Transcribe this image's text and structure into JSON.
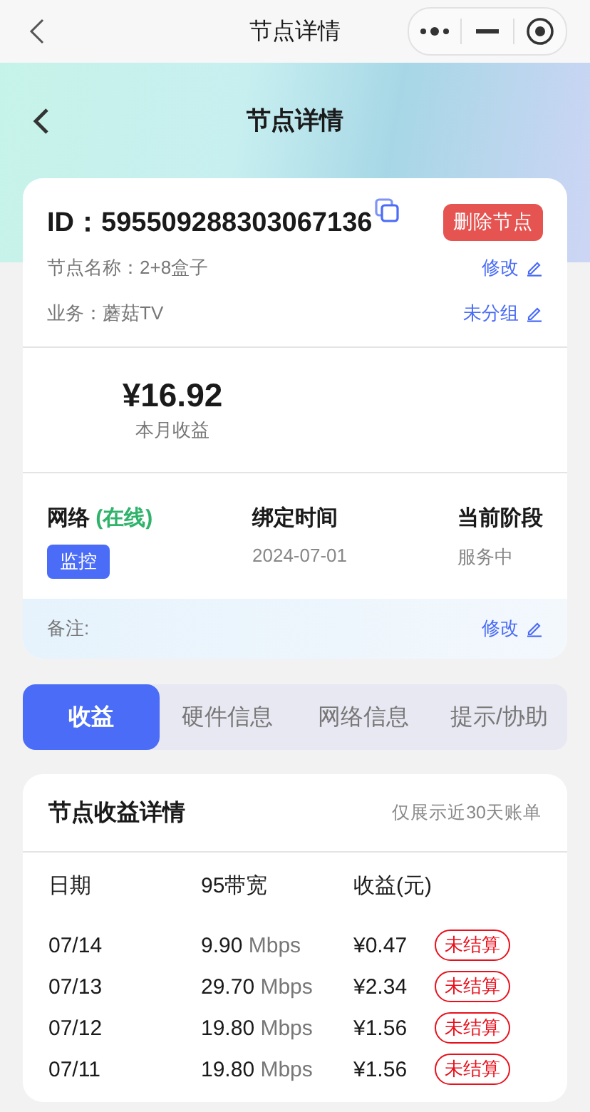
{
  "mini_bar": {
    "title": "节点详情"
  },
  "header": {
    "title": "节点详情"
  },
  "node": {
    "id_label": "ID：",
    "id": "595509288303067136",
    "delete_button": "删除节点",
    "name": "节点名称：2+8盒子",
    "name_action": "修改",
    "business": "业务：蘑菇TV",
    "group_action": "未分组",
    "income": "¥16.92",
    "income_label": "本月收益",
    "network_label": "网络",
    "network_status": "(在线)",
    "online": true,
    "monitor_button": "监控",
    "bind_label": "绑定时间",
    "bind_value": "2024-07-01",
    "stage_label": "当前阶段",
    "stage_value": "服务中",
    "note_label": "备注:",
    "note_action": "修改"
  },
  "tabs": [
    {
      "label": "收益",
      "selected": true
    },
    {
      "label": "硬件信息",
      "selected": false
    },
    {
      "label": "网络信息",
      "selected": false
    },
    {
      "label": "提示/协助",
      "selected": false
    }
  ],
  "income_detail": {
    "title": "节点收益详情",
    "hint": "仅展示近30天账单",
    "columns": [
      "日期",
      "95带宽",
      "收益(元)"
    ],
    "rows": [
      {
        "date": "07/14",
        "bandwidth": "9.90",
        "unit": "Mbps",
        "amount": "¥0.47",
        "status": "未结算"
      },
      {
        "date": "07/13",
        "bandwidth": "29.70",
        "unit": "Mbps",
        "amount": "¥2.34",
        "status": "未结算"
      },
      {
        "date": "07/12",
        "bandwidth": "19.80",
        "unit": "Mbps",
        "amount": "¥1.56",
        "status": "未结算"
      },
      {
        "date": "07/11",
        "bandwidth": "19.80",
        "unit": "Mbps",
        "amount": "¥1.56",
        "status": "未结算"
      }
    ]
  }
}
